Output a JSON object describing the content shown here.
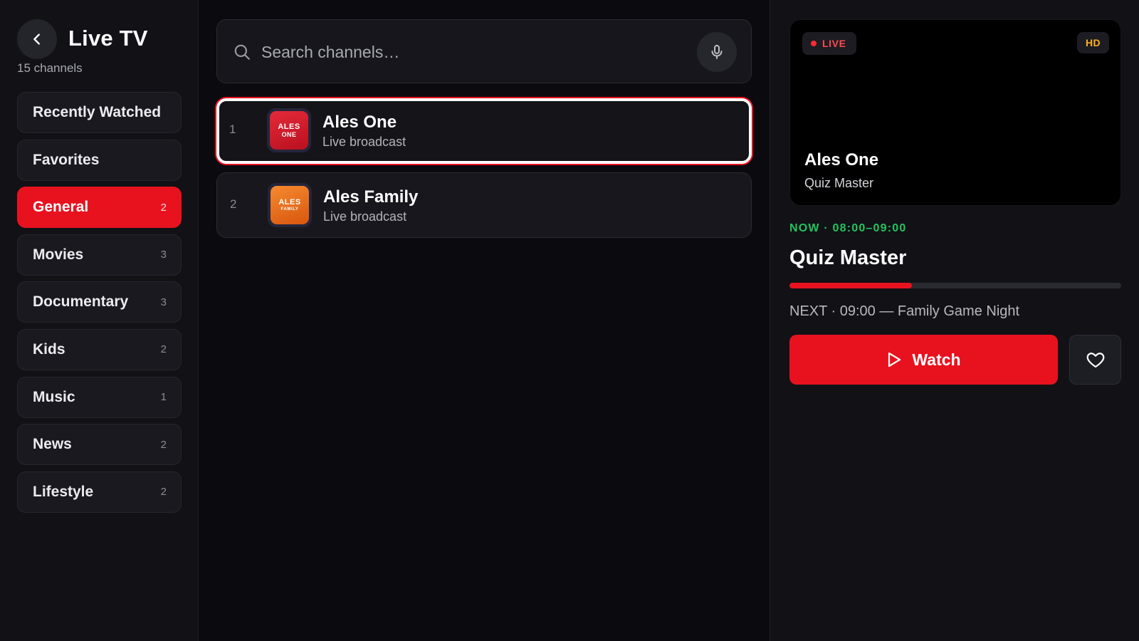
{
  "header": {
    "title": "Live TV",
    "channel_count": "15 channels"
  },
  "categories": [
    {
      "label": "Recently Watched",
      "count": "",
      "active": false
    },
    {
      "label": "Favorites",
      "count": "",
      "active": false
    },
    {
      "label": "General",
      "count": "2",
      "active": true
    },
    {
      "label": "Movies",
      "count": "3",
      "active": false
    },
    {
      "label": "Documentary",
      "count": "3",
      "active": false
    },
    {
      "label": "Kids",
      "count": "2",
      "active": false
    },
    {
      "label": "Music",
      "count": "1",
      "active": false
    },
    {
      "label": "News",
      "count": "2",
      "active": false
    },
    {
      "label": "Lifestyle",
      "count": "2",
      "active": false
    }
  ],
  "search": {
    "placeholder": "Search channels…",
    "value": ""
  },
  "channels": [
    {
      "number": "1",
      "name": "Ales One",
      "subtitle": "Live broadcast",
      "logo_line1": "ALES",
      "logo_line2": "ONE",
      "logo_color": "#d31a2b",
      "selected": true
    },
    {
      "number": "2",
      "name": "Ales Family",
      "subtitle": "Live broadcast",
      "logo_line1": "ALES",
      "logo_line2": "FAMILY",
      "logo_color": "#ec6a1c",
      "selected": false
    }
  ],
  "preview": {
    "live_label": "LIVE",
    "quality_label": "HD",
    "channel_name": "Ales One",
    "program_name": "Quiz Master"
  },
  "now_playing": {
    "now_line": "NOW · 08:00–09:00",
    "title": "Quiz Master",
    "progress_fraction": 0.37,
    "next_line": "NEXT · 09:00 — Family Game Night"
  },
  "actions": {
    "watch_label": "Watch"
  },
  "colors": {
    "accent": "#e8121f",
    "now_green": "#22c55e",
    "hd_amber": "#ffb020"
  },
  "icons": {
    "back": "chevron-left-icon",
    "search": "search-icon",
    "mic": "microphone-icon",
    "play": "play-icon",
    "favorite": "heart-icon"
  }
}
